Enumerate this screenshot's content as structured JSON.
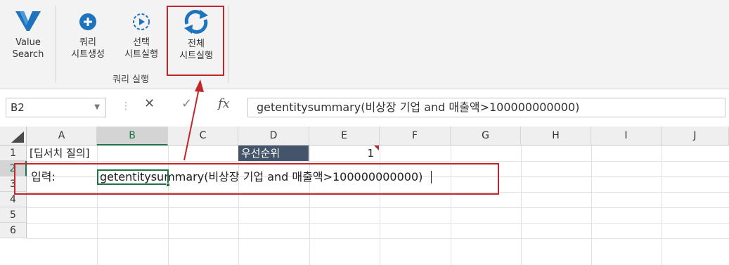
{
  "ribbon": {
    "value_search": {
      "line1": "Value",
      "line2": "Search",
      "icon": "value-search-logo-icon"
    },
    "query_create": {
      "line1": "쿼리",
      "line2": "시트생성",
      "icon": "plus-circle-icon"
    },
    "run_selected": {
      "line1": "선택",
      "line2": "시트실행",
      "icon": "play-circle-icon"
    },
    "run_all": {
      "line1": "전체",
      "line2": "시트실행",
      "icon": "refresh-cycle-icon"
    },
    "group_label": "쿼리 실행",
    "accent_color": "#1e73be",
    "highlight_color": "#c0262b"
  },
  "formula_bar": {
    "name_box": "B2",
    "cancel_symbol": "✕",
    "enter_symbol": "✓",
    "fx_symbol": "fx",
    "formula": "getentitysummary(비상장 기업 and 매출액>100000000000)"
  },
  "grid": {
    "columns": [
      "A",
      "B",
      "C",
      "D",
      "E",
      "F",
      "G",
      "H",
      "I",
      "J"
    ],
    "rows": [
      "1",
      "2",
      "3",
      "4",
      "5",
      "6"
    ],
    "cells": {
      "A1": "[딥서치 질의]",
      "D1": "우선순위",
      "E1": "1",
      "A2": "입력:",
      "B2": "getentitysummary(비상장 기업 and 매출액>100000000000)"
    },
    "selected_cell": "B2",
    "header_color": "#44546a"
  }
}
